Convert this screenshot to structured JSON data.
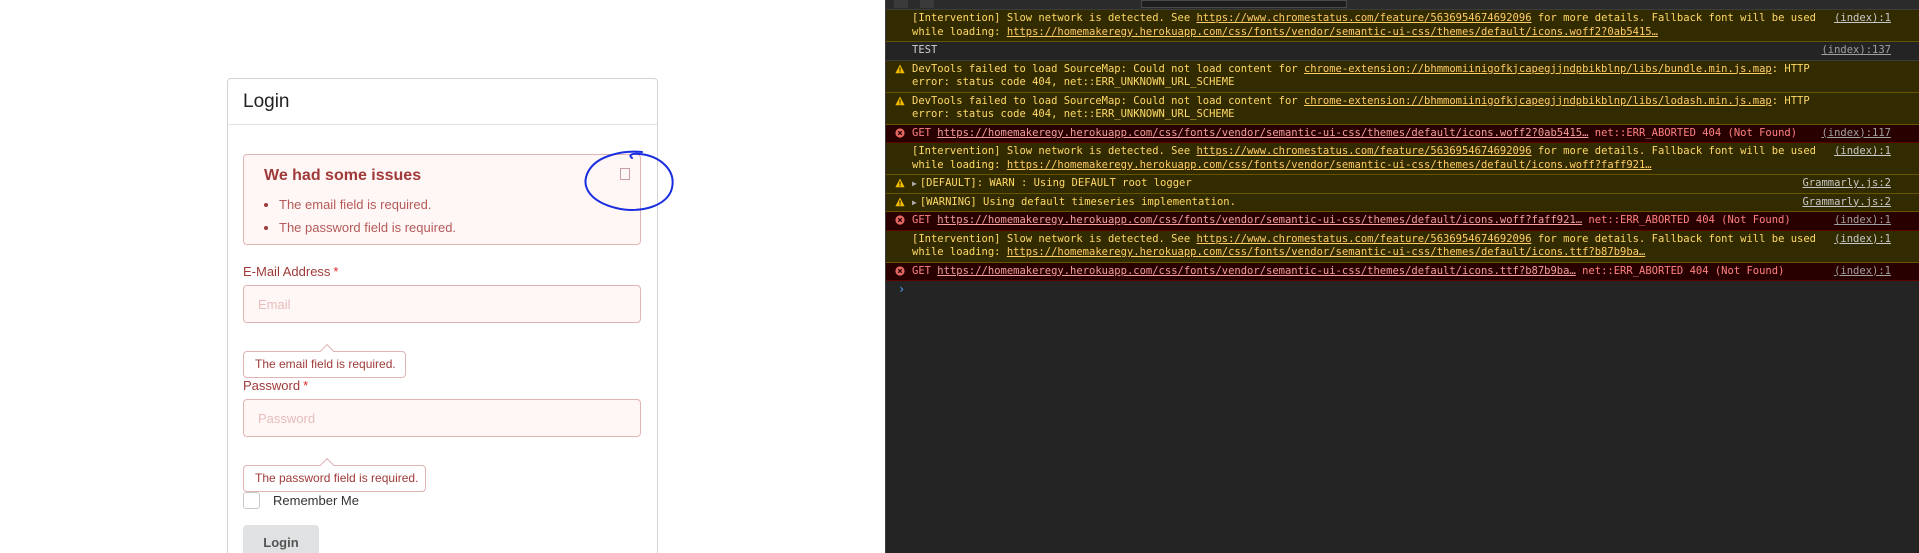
{
  "login": {
    "title": "Login",
    "alert": {
      "title": "We had some issues",
      "items": [
        "The email field is required.",
        "The password field is required."
      ]
    },
    "email": {
      "label": "E-Mail Address",
      "required_mark": "*",
      "placeholder": "Email",
      "value": "",
      "error": "The email field is required."
    },
    "password": {
      "label": "Password",
      "required_mark": "*",
      "placeholder": "Password",
      "value": "",
      "error": "The password field is required."
    },
    "remember_label": "Remember Me",
    "remember_checked": false,
    "submit_label": "Login"
  },
  "annotation": {
    "color": "#1a2ee0"
  },
  "devtools": {
    "colors": {
      "warn_bg": "#332b00",
      "error_bg": "#290000",
      "prompt": "#4da3ff"
    },
    "rows": [
      {
        "level": "warn",
        "icon": "",
        "pre": "[Intervention] Slow network is detected. See ",
        "link": "https://www.chromestatus.com/feature/5636954674692096",
        "post": " for more details. Fallback font will be used while loading: ",
        "link2": "https://homemakeregy.herokuapp.com/css/fonts/vendor/semantic-ui-css/themes/default/icons.woff2?0ab5415…",
        "source": "(index):1"
      },
      {
        "level": "info",
        "icon": "",
        "pre": "TEST",
        "link": "",
        "post": "",
        "link2": "",
        "source": "(index):137"
      },
      {
        "level": "warn",
        "icon": "warning-icon",
        "pre": "DevTools failed to load SourceMap: Could not load content for ",
        "link": "chrome-extension://bhmmomiinigofkjcapegjjndpbikblnp/libs/bundle.min.js.map",
        "post": ": HTTP error: status code 404, net::ERR_UNKNOWN_URL_SCHEME",
        "link2": "",
        "source": ""
      },
      {
        "level": "warn",
        "icon": "warning-icon",
        "pre": "DevTools failed to load SourceMap: Could not load content for ",
        "link": "chrome-extension://bhmmomiinigofkjcapegjjndpbikblnp/libs/lodash.min.js.map",
        "post": ": HTTP error: status code 404, net::ERR_UNKNOWN_URL_SCHEME",
        "link2": "",
        "source": ""
      },
      {
        "level": "error",
        "icon": "error-icon",
        "pre": "GET ",
        "link": "https://homemakeregy.herokuapp.com/css/fonts/vendor/semantic-ui-css/themes/default/icons.woff2?0ab5415…",
        "post": " net::ERR_ABORTED 404 (Not Found)",
        "link2": "",
        "source": "(index):117"
      },
      {
        "level": "warn",
        "icon": "",
        "pre": "[Intervention] Slow network is detected. See ",
        "link": "https://www.chromestatus.com/feature/5636954674692096",
        "post": " for more details. Fallback font will be used while loading: ",
        "link2": "https://homemakeregy.herokuapp.com/css/fonts/vendor/semantic-ui-css/themes/default/icons.woff?faff921…",
        "source": "(index):1"
      },
      {
        "level": "warn",
        "icon": "warning-icon",
        "expand": "▶",
        "pre": "[DEFAULT]: WARN : Using DEFAULT root logger",
        "link": "",
        "post": "",
        "link2": "",
        "source": "Grammarly.js:2"
      },
      {
        "level": "warn",
        "icon": "warning-icon",
        "expand": "▶",
        "pre": "[WARNING] Using default timeseries implementation.",
        "link": "",
        "post": "",
        "link2": "",
        "source": "Grammarly.js:2"
      },
      {
        "level": "error",
        "icon": "error-icon",
        "pre": "GET ",
        "link": "https://homemakeregy.herokuapp.com/css/fonts/vendor/semantic-ui-css/themes/default/icons.woff?faff921…",
        "post": " net::ERR_ABORTED 404 (Not Found)",
        "link2": "",
        "source": "(index):1"
      },
      {
        "level": "warn",
        "icon": "",
        "pre": "[Intervention] Slow network is detected. See ",
        "link": "https://www.chromestatus.com/feature/5636954674692096",
        "post": " for more details. Fallback font will be used while loading: ",
        "link2": "https://homemakeregy.herokuapp.com/css/fonts/vendor/semantic-ui-css/themes/default/icons.ttf?b87b9ba…",
        "source": "(index):1"
      },
      {
        "level": "error",
        "icon": "error-icon",
        "pre": "GET ",
        "link": "https://homemakeregy.herokuapp.com/css/fonts/vendor/semantic-ui-css/themes/default/icons.ttf?b87b9ba…",
        "post": " net::ERR_ABORTED 404 (Not Found)",
        "link2": "",
        "source": "(index):1"
      }
    ],
    "prompt_glyph": "›"
  }
}
